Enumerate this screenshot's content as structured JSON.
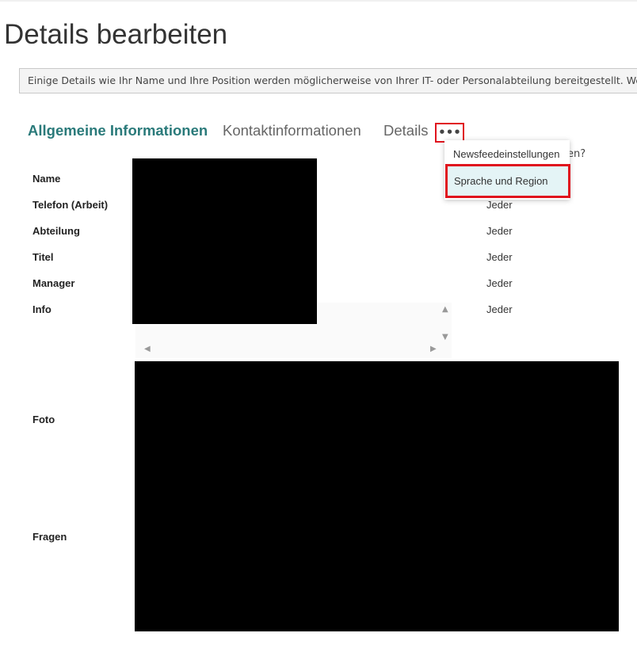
{
  "page": {
    "title": "Details bearbeiten",
    "notice": "Einige Details wie Ihr Name und Ihre Position werden möglicherweise von Ihrer IT- oder Personalabteilung bereitgestellt. Wenn Sie dies"
  },
  "tabs": [
    {
      "label": "Allgemeine Informationen",
      "active": true
    },
    {
      "label": "Kontaktinformationen",
      "active": false
    },
    {
      "label": "Details",
      "active": false
    }
  ],
  "more_menu": {
    "button_label": "•••",
    "items": [
      {
        "label": "Newsfeedeinstellungen"
      },
      {
        "label": "Sprache und Region"
      }
    ]
  },
  "visibility_header_fragment": "en?",
  "fields": [
    {
      "label": "Name",
      "visibility": ""
    },
    {
      "label": "Telefon (Arbeit)",
      "visibility": "Jeder"
    },
    {
      "label": "Abteilung",
      "visibility": "Jeder"
    },
    {
      "label": "Titel",
      "visibility": "Jeder"
    },
    {
      "label": "Manager",
      "visibility": "Jeder"
    },
    {
      "label": "Info",
      "visibility": "Jeder"
    },
    {
      "label": "Foto",
      "visibility": ""
    },
    {
      "label": "Fragen",
      "visibility": ""
    }
  ],
  "colors": {
    "accent": "#2a7a7a",
    "highlight_border": "#e0141e",
    "menu_hover": "#e4f4f6"
  },
  "icons": {
    "more": "ellipsis-icon",
    "scroll_up": "triangle-up-icon",
    "scroll_down": "triangle-down-icon",
    "scroll_left": "triangle-left-icon",
    "scroll_right": "triangle-right-icon"
  }
}
